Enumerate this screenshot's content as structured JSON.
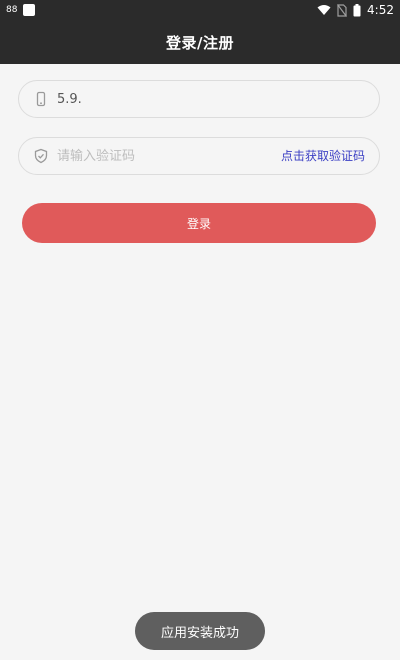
{
  "status_bar": {
    "left_glyph": "88",
    "time": "4:52",
    "icons": [
      "app-square-icon",
      "wifi-icon",
      "no-sim-icon",
      "battery-icon"
    ]
  },
  "header": {
    "title": "登录/注册"
  },
  "form": {
    "phone": {
      "icon": "phone-icon",
      "value": "5.9.",
      "placeholder": ""
    },
    "code": {
      "icon": "shield-icon",
      "value": "",
      "placeholder": "请输入验证码",
      "get_code_label": "点击获取验证码"
    },
    "login_label": "登录"
  },
  "toast": {
    "message": "应用安装成功"
  },
  "colors": {
    "header_bg": "#2b2b2b",
    "page_bg": "#f5f5f5",
    "primary_button": "#e05a5a",
    "link": "#3b3fc4",
    "toast_bg": "#5f5f5f"
  }
}
